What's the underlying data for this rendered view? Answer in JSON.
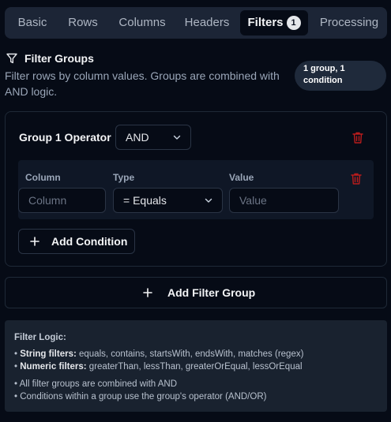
{
  "tabs": [
    {
      "label": "Basic"
    },
    {
      "label": "Rows"
    },
    {
      "label": "Columns"
    },
    {
      "label": "Headers"
    },
    {
      "label": "Filters",
      "badge": "1",
      "active": true
    },
    {
      "label": "Processing"
    }
  ],
  "filter_groups": {
    "icon": "filter-icon",
    "title": "Filter Groups",
    "description": "Filter rows by column values. Groups are combined with AND logic.",
    "count_badge": "1 group, 1 condition"
  },
  "group": {
    "operator_label": "Group 1 Operator",
    "operator_value": "AND",
    "columns": {
      "column": "Column",
      "type": "Type",
      "value": "Value"
    },
    "condition": {
      "column_placeholder": "Column",
      "type_value": "= Equals",
      "value_placeholder": "Value"
    },
    "add_condition_label": "Add Condition"
  },
  "add_filter_group_label": "Add Filter Group",
  "logic": {
    "title": "Filter Logic:",
    "string_label": "String filters:",
    "string_text": "equals, contains, startsWith, endsWith, matches (regex)",
    "numeric_label": "Numeric filters:",
    "numeric_text": "greaterThan, lessThan, greaterOrEqual, lessOrEqual",
    "note1": "All filter groups are combined with AND",
    "note2": "Conditions within a group use the group's operator (AND/OR)"
  },
  "colors": {
    "background": "#060b16",
    "tab_bar": "#1c2536",
    "danger": "#b91c1c",
    "panel": "#19222f"
  }
}
